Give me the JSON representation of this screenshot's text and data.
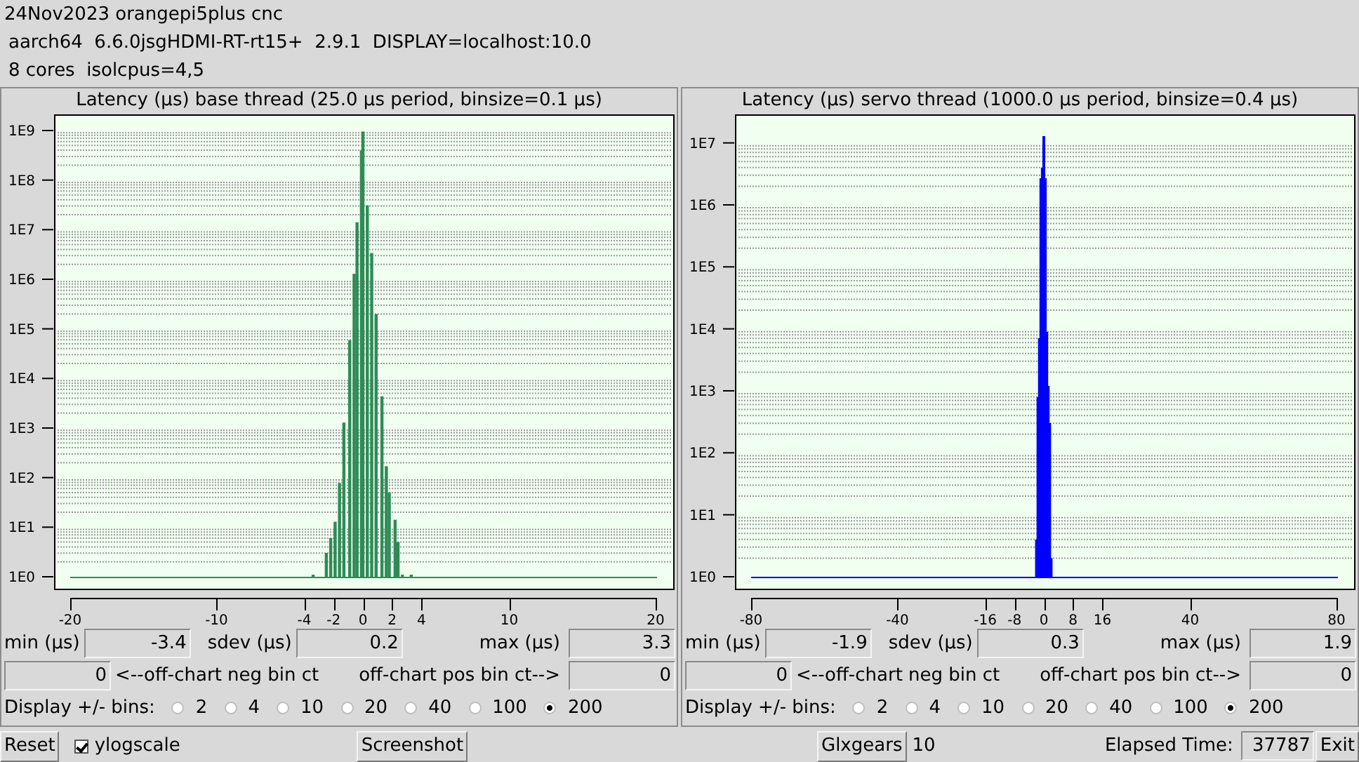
{
  "header": {
    "lines": [
      "24Nov2023 orangepi5plus cnc",
      "aarch64  6.6.0jsgHDMI-RT-rt15+  2.9.1  DISPLAY=localhost:10.0",
      "8 cores  isolcpus=4,5"
    ]
  },
  "panels": [
    {
      "title": "Latency (µs) base thread (25.0 µs period, binsize=0.1 µs)",
      "color": "#2e8b57",
      "x_axis_labels": [
        "-20",
        "-10",
        "-4",
        "-2",
        "0",
        "2",
        "4",
        "10",
        "20"
      ],
      "y_axis_labels": [
        "1E9",
        "1E8",
        "1E7",
        "1E6",
        "1E5",
        "1E4",
        "1E3",
        "1E2",
        "1E1",
        "1E0"
      ],
      "stats": [
        {
          "label": "min (µs)",
          "value": "-3.4"
        },
        {
          "label": "sdev (µs)",
          "value": "0.2"
        },
        {
          "label": "max (µs)",
          "value": "3.3"
        }
      ],
      "offchart": {
        "neg_value": "0",
        "neg_label": "<--off-chart neg bin ct",
        "pos_label": "off-chart pos bin ct-->",
        "pos_value": "0"
      },
      "bins": {
        "label": "Display +/- bins:",
        "options": [
          {
            "label": "2",
            "selected": false
          },
          {
            "label": "4",
            "selected": false
          },
          {
            "label": "10",
            "selected": false
          },
          {
            "label": "20",
            "selected": false
          },
          {
            "label": "40",
            "selected": false
          },
          {
            "label": "100",
            "selected": false
          },
          {
            "label": "200",
            "selected": true
          }
        ]
      }
    },
    {
      "title": "Latency (µs) servo thread (1000.0 µs period, binsize=0.4 µs)",
      "color": "#0000ff",
      "x_axis_labels": [
        "-80",
        "-40",
        "-16",
        "-8",
        "0",
        "8",
        "16",
        "40",
        "80"
      ],
      "y_axis_labels": [
        "1E7",
        "1E6",
        "1E5",
        "1E4",
        "1E3",
        "1E2",
        "1E1",
        "1E0"
      ],
      "stats": [
        {
          "label": "min (µs)",
          "value": "-1.9"
        },
        {
          "label": "sdev (µs)",
          "value": "0.3"
        },
        {
          "label": "max (µs)",
          "value": "1.9"
        }
      ],
      "offchart": {
        "neg_value": "0",
        "neg_label": "<--off-chart neg bin ct",
        "pos_label": "off-chart pos bin ct-->",
        "pos_value": "0"
      },
      "bins": {
        "label": "Display +/- bins:",
        "options": [
          {
            "label": "2",
            "selected": false
          },
          {
            "label": "4",
            "selected": false
          },
          {
            "label": "10",
            "selected": false
          },
          {
            "label": "20",
            "selected": false
          },
          {
            "label": "40",
            "selected": false
          },
          {
            "label": "100",
            "selected": false
          },
          {
            "label": "200",
            "selected": true
          }
        ]
      }
    }
  ],
  "footer": {
    "reset": "Reset",
    "ylogscale": {
      "label": "ylogscale",
      "checked": true
    },
    "screenshot": "Screenshot",
    "glxgears": "Glxgears",
    "glxgears_count": "10",
    "elapsed_label": "Elapsed Time:",
    "elapsed": "37787",
    "exit": "Exit"
  }
}
